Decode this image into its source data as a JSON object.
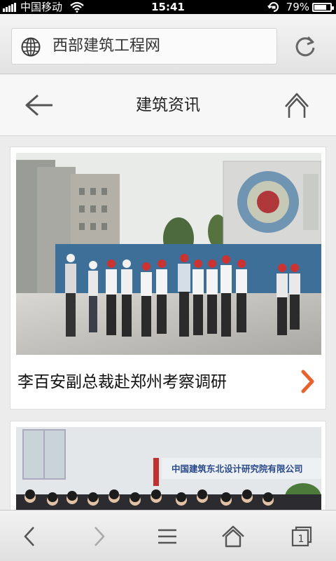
{
  "status_bar": {
    "carrier": "中国移动",
    "time": "15:41",
    "battery": "79%",
    "battery_level": 0.79
  },
  "browser": {
    "url_text": "西部建筑工程网",
    "globe_icon": "globe-icon",
    "reload_icon": "reload-icon"
  },
  "header": {
    "title": "建筑资讯",
    "back_icon": "back-arrow-icon",
    "home_icon": "home-icon"
  },
  "articles": [
    {
      "title": "李百安副总裁赴郑州考察调研",
      "image": "site-inspection-photo",
      "icon": "chevron-right-icon"
    },
    {
      "title": "",
      "image": "meeting-room-photo",
      "sign_text": "中国建筑东北设计研究院有限公司"
    }
  ],
  "toolbar": {
    "tab_count": "1",
    "icons": [
      "back-icon",
      "forward-icon",
      "menu-icon",
      "home-icon",
      "tabs-icon"
    ]
  },
  "colors": {
    "accent": "#e8622c",
    "background": "#ececec",
    "card": "#ffffff"
  }
}
